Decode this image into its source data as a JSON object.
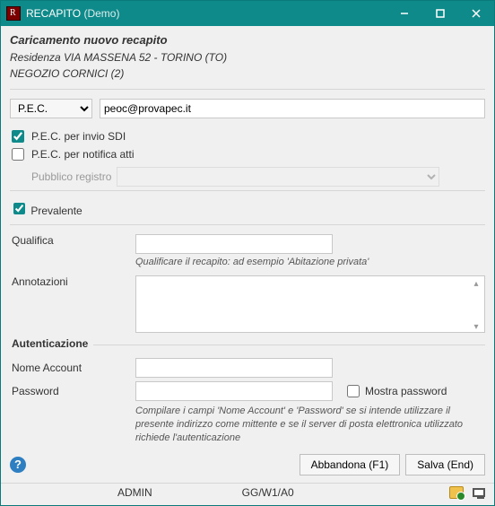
{
  "window": {
    "title": "RECAPITO",
    "demo": "(Demo)"
  },
  "header": {
    "line1": "Caricamento nuovo recapito",
    "line2": "Residenza VIA MASSENA 52 - TORINO (TO)",
    "line3": "NEGOZIO CORNICI (2)"
  },
  "form": {
    "type_options": [
      "P.E.C."
    ],
    "type_value": "P.E.C.",
    "address_value": "peoc@provapec.it",
    "pec_sdi": {
      "label": "P.E.C. per invio SDI",
      "checked": true
    },
    "pec_atti": {
      "label": "P.E.C. per notifica atti",
      "checked": false
    },
    "registro": {
      "label": "Pubblico registro",
      "value": ""
    },
    "prevalente": {
      "label": "Prevalente",
      "checked": true
    },
    "qualifica": {
      "label": "Qualifica",
      "value": "",
      "hint": "Qualificare il recapito: ad esempio 'Abitazione privata'"
    },
    "annotazioni": {
      "label": "Annotazioni",
      "value": ""
    }
  },
  "auth": {
    "legend": "Autenticazione",
    "account": {
      "label": "Nome Account",
      "value": ""
    },
    "password": {
      "label": "Password",
      "value": ""
    },
    "show_pw": {
      "label": "Mostra password",
      "checked": false
    },
    "hint": "Compilare i campi 'Nome Account' e 'Password' se si intende utilizzare il presente indirizzo come mittente e se il server di posta elettronica utilizzato richiede l'autenticazione"
  },
  "buttons": {
    "abandon": "Abbandona (F1)",
    "save": "Salva (End)"
  },
  "status": {
    "user": "ADMIN",
    "code": "GG/W1/A0"
  }
}
